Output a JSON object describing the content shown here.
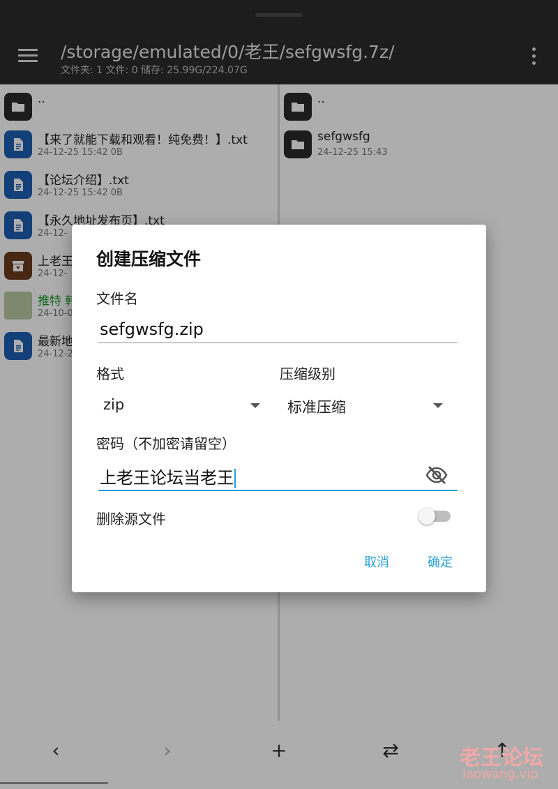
{
  "header": {
    "path": "/storage/emulated/0/老王/sefgwsfg.7z/",
    "info": "文件夹: 1  文件: 0  储存: 25.99G/224.07G"
  },
  "left_pane": {
    "items": [
      {
        "name": "..",
        "meta": "",
        "icon": "folder-icon"
      },
      {
        "name": "【来了就能下载和观看！纯免费！】.txt",
        "meta": "24-12-25 15:42  0B",
        "icon": "document-icon"
      },
      {
        "name": "【论坛介绍】.txt",
        "meta": "24-12-25 15:42  0B",
        "icon": "document-icon"
      },
      {
        "name": "【永久地址发布页】.txt",
        "meta": "24-12-",
        "icon": "document-icon"
      },
      {
        "name": "上老王",
        "meta": "24-12-",
        "icon": "archive-icon"
      },
      {
        "name": "推特 韩",
        "meta": "24-10-0",
        "icon": "image-thumbnail"
      },
      {
        "name": "最新地",
        "meta": "24-12-2",
        "icon": "document-icon"
      }
    ]
  },
  "right_pane": {
    "items": [
      {
        "name": "..",
        "meta": "",
        "icon": "folder-icon"
      },
      {
        "name": "sefgwsfg",
        "meta": "24-12-25 15:43",
        "icon": "folder-icon"
      }
    ]
  },
  "dialog": {
    "title": "创建压缩文件",
    "filename_label": "文件名",
    "filename_value": "sefgwsfg.zip",
    "format_label": "格式",
    "format_value": "zip",
    "level_label": "压缩级别",
    "level_value": "标准压缩",
    "password_label": "密码（不加密请留空）",
    "password_value": "上老王论坛当老王",
    "delete_source_label": "删除源文件",
    "delete_source_enabled": false,
    "cancel_label": "取消",
    "confirm_label": "确定"
  },
  "bottom_nav": {
    "back": "‹",
    "forward": "›",
    "add": "+",
    "swap": "⇄",
    "up": "↑"
  },
  "watermark": {
    "name": "老王论坛",
    "url": "laowang.vip"
  },
  "colors": {
    "accent": "#2a9fd6",
    "topbar": "#2b2b2b",
    "doc_icon": "#1e5fb3",
    "green_text": "#1a9a2a"
  }
}
